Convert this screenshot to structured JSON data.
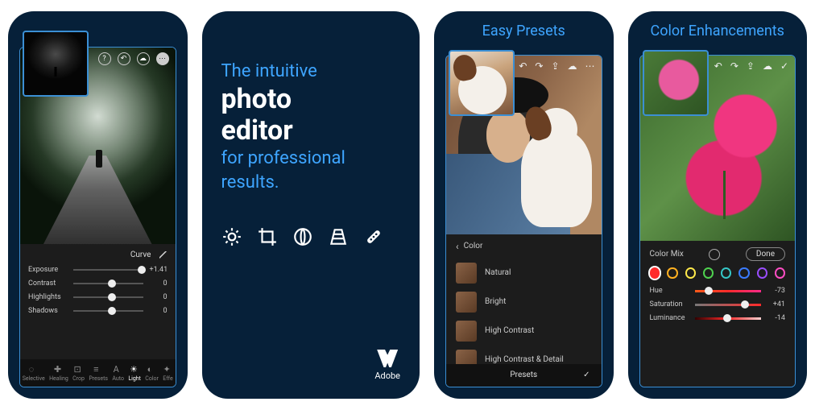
{
  "panel1": {
    "tab_label": "Curve",
    "sliders": [
      {
        "label": "Exposure",
        "value": "+1.41",
        "pos": 92
      },
      {
        "label": "Contrast",
        "value": "0",
        "pos": 50
      },
      {
        "label": "Highlights",
        "value": "0",
        "pos": 50
      },
      {
        "label": "Shadows",
        "value": "0",
        "pos": 50
      }
    ],
    "bottom_nav": [
      "Selective",
      "Healing",
      "Crop",
      "Presets",
      "Auto",
      "Light",
      "Color",
      "Effe"
    ]
  },
  "panel2": {
    "line1": "The intuitive",
    "bold1": "photo",
    "bold2": "editor",
    "line2": "for professional",
    "line3": "results.",
    "brand": "Adobe"
  },
  "panel3": {
    "title": "Easy Presets",
    "section": "Color",
    "presets": [
      "Natural",
      "Bright",
      "High Contrast",
      "High Contrast & Detail"
    ],
    "footer": "Presets"
  },
  "panel4": {
    "title": "Color Enhancements",
    "section": "Color Mix",
    "done": "Done",
    "swatches": [
      "#ff2a2a",
      "#ffb020",
      "#ffe94a",
      "#4fd24f",
      "#35c7c7",
      "#3a7bff",
      "#9a4dff",
      "#ff4dc4"
    ],
    "sliders": [
      {
        "label": "Hue",
        "value": "-73",
        "pos": 15,
        "grad": "linear-gradient(90deg,#ff5a1a,#ff2a2a,#ff2a8a)"
      },
      {
        "label": "Saturation",
        "value": "+41",
        "pos": 70,
        "grad": "linear-gradient(90deg,#777,#ff2a2a)"
      },
      {
        "label": "Luminance",
        "value": "-14",
        "pos": 43,
        "grad": "linear-gradient(90deg,#300,#ff2a2a,#ffd0d0)"
      }
    ]
  }
}
